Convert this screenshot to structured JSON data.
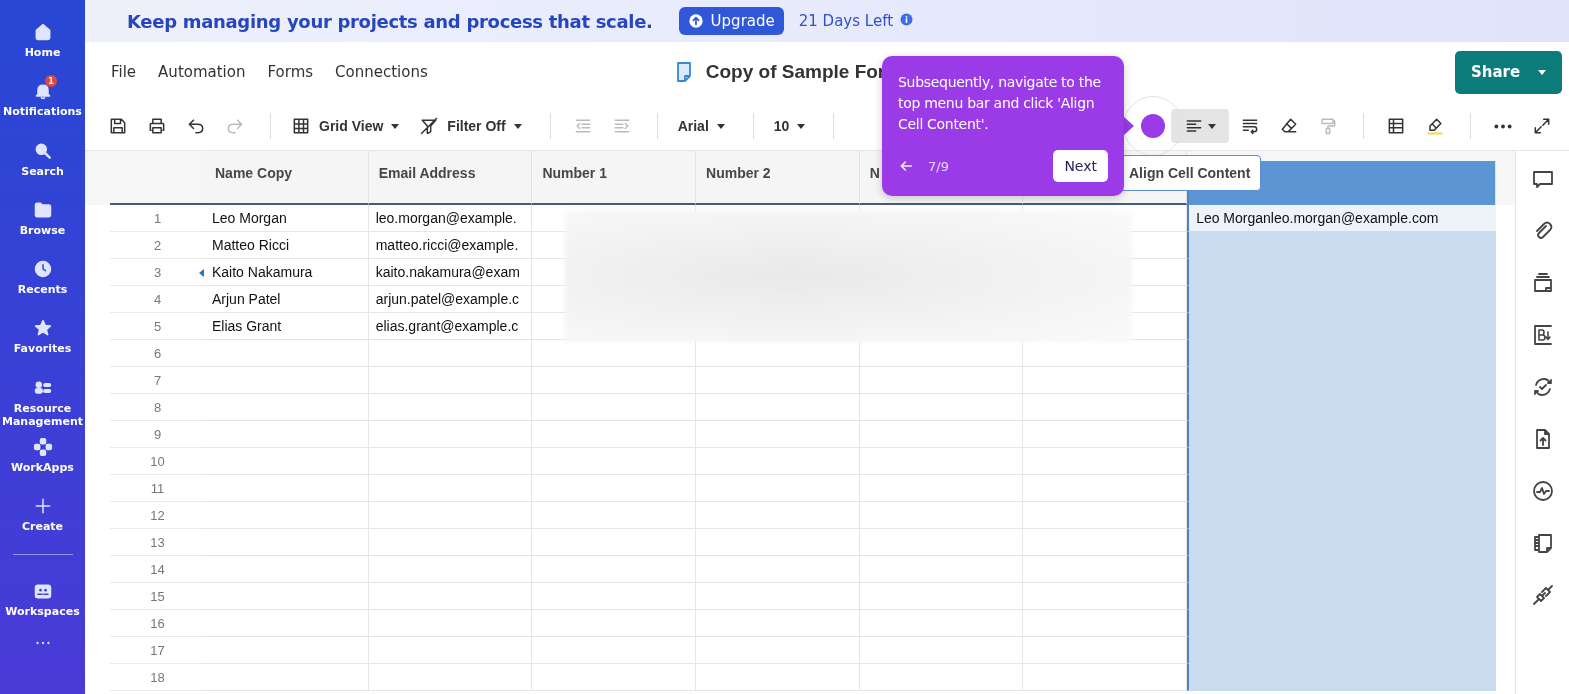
{
  "banner": {
    "message": "Keep managing your projects and process that scale.",
    "upgrade_button": "Upgrade",
    "days_left": "21 Days Left"
  },
  "sidebar": {
    "items": [
      {
        "kind": "home",
        "label": "Home"
      },
      {
        "kind": "bell",
        "label": "Notifications",
        "badge": "1"
      },
      {
        "kind": "search",
        "label": "Search"
      },
      {
        "kind": "folder",
        "label": "Browse"
      },
      {
        "kind": "clock",
        "label": "Recents"
      },
      {
        "kind": "star",
        "label": "Favorites"
      },
      {
        "kind": "people",
        "label": "Resource Management"
      },
      {
        "kind": "apps",
        "label": "WorkApps"
      },
      {
        "kind": "plus",
        "label": "Create"
      },
      {
        "kind": "divider"
      },
      {
        "kind": "workspaces",
        "label": "Workspaces"
      },
      {
        "kind": "more"
      }
    ]
  },
  "menu": [
    "File",
    "Automation",
    "Forms",
    "Connections"
  ],
  "document_title": "Copy of Sample For",
  "share_button": "Share",
  "toolbar": {
    "left": [
      {
        "kind": "save",
        "disabled": false,
        "active": false
      },
      {
        "kind": "print",
        "disabled": false,
        "active": false
      },
      {
        "kind": "undo",
        "disabled": false,
        "active": false
      },
      {
        "kind": "redo",
        "disabled": true,
        "active": false
      },
      {
        "kind": "separator"
      },
      {
        "kind": "view",
        "label": "Grid View"
      },
      {
        "kind": "filter",
        "label": "Filter Off"
      },
      {
        "kind": "separator"
      },
      {
        "kind": "outdent",
        "disabled": true,
        "active": false
      },
      {
        "kind": "indent",
        "disabled": true,
        "active": false
      },
      {
        "kind": "separator"
      },
      {
        "kind": "dropdown",
        "label": "Arial"
      },
      {
        "kind": "separator"
      },
      {
        "kind": "dropdown",
        "label": "10"
      },
      {
        "kind": "separator"
      }
    ],
    "right": [
      {
        "kind": "align",
        "disabled": false,
        "active": true
      },
      {
        "kind": "wrap",
        "disabled": false,
        "active": false
      },
      {
        "kind": "eraser",
        "disabled": false,
        "active": false
      },
      {
        "kind": "roller",
        "disabled": true,
        "active": false
      },
      {
        "kind": "separator"
      },
      {
        "kind": "table",
        "disabled": false,
        "active": false
      },
      {
        "kind": "highlighter",
        "disabled": false,
        "active": false
      },
      {
        "kind": "separator"
      },
      {
        "kind": "more",
        "disabled": false,
        "active": false
      },
      {
        "kind": "expand",
        "disabled": false,
        "active": false
      }
    ]
  },
  "grid": {
    "columns": [
      {
        "header": "Name Copy",
        "selected": false
      },
      {
        "header": "Email Address",
        "selected": false
      },
      {
        "header": "Number 1",
        "selected": false
      },
      {
        "header": "Number 2",
        "selected": false
      },
      {
        "header": "N",
        "selected": false
      },
      {
        "selected": false
      },
      {
        "selected": true
      }
    ],
    "rows": [
      {
        "number": "1",
        "current": false,
        "name_copy": "Leo Morgan",
        "email_address": "leo.morgan@example.",
        "column_7": "Leo Morganleo.morgan@example.com"
      },
      {
        "number": "2",
        "current": false,
        "name_copy": "Matteo Ricci",
        "email_address": "matteo.ricci@example."
      },
      {
        "number": "3",
        "current": true,
        "name_copy": "Kaito Nakamura",
        "email_address": "kaito.nakamura@exam"
      },
      {
        "number": "4",
        "current": false,
        "name_copy": "Arjun Patel",
        "email_address": "arjun.patel@example.c"
      },
      {
        "number": "5",
        "current": false,
        "name_copy": "Elias Grant",
        "email_address": "elias.grant@example.c"
      },
      {
        "number": "6",
        "current": false
      },
      {
        "number": "7",
        "current": false
      },
      {
        "number": "8",
        "current": false
      },
      {
        "number": "9",
        "current": false
      },
      {
        "number": "10",
        "current": false
      },
      {
        "number": "11",
        "current": false
      },
      {
        "number": "12",
        "current": false
      },
      {
        "number": "13",
        "current": false
      },
      {
        "number": "14",
        "current": false
      },
      {
        "number": "15",
        "current": false
      },
      {
        "number": "16",
        "current": false
      },
      {
        "number": "17",
        "current": false
      },
      {
        "number": "18",
        "current": false
      }
    ]
  },
  "right_panel": [
    {
      "kind": "comment"
    },
    {
      "kind": "attachment"
    },
    {
      "kind": "stack"
    },
    {
      "kind": "bold-download"
    },
    {
      "kind": "sync"
    },
    {
      "kind": "upload"
    },
    {
      "kind": "activity"
    },
    {
      "kind": "document"
    },
    {
      "kind": "plug"
    }
  ],
  "walkthrough": {
    "text": "Subsequently, navigate to the top menu bar and click 'Align Cell Content'.",
    "step": "7/9",
    "next_button": "Next"
  },
  "hover_tooltip": "Align Cell Content"
}
